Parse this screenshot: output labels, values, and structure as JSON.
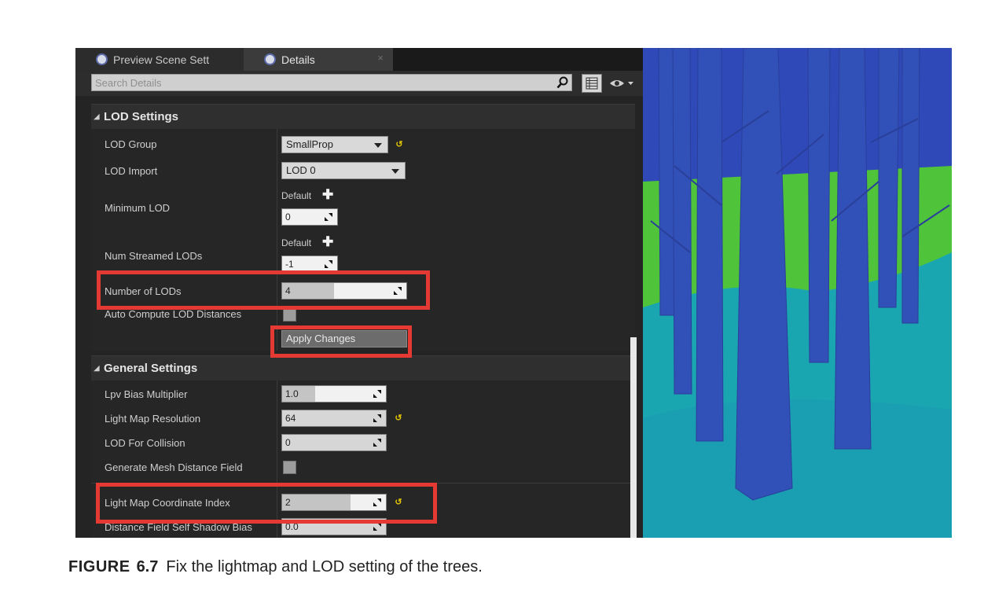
{
  "tabs": {
    "preview_label": "Preview Scene Sett",
    "details_label": "Details",
    "close_glyph": "×"
  },
  "search": {
    "placeholder": "Search Details"
  },
  "lod_settings": {
    "title": "LOD Settings",
    "lod_group": {
      "label": "LOD Group",
      "value": "SmallProp"
    },
    "lod_import": {
      "label": "LOD Import",
      "value": "LOD 0"
    },
    "minimum_lod": {
      "label": "Minimum LOD",
      "default_label": "Default",
      "value": "0"
    },
    "num_streamed_lods": {
      "label": "Num Streamed LODs",
      "default_label": "Default",
      "value": "-1"
    },
    "number_of_lods": {
      "label": "Number of LODs",
      "value": "4",
      "slider_fraction": 0.42
    },
    "auto_compute": {
      "label": "Auto Compute LOD Distances",
      "checked": false
    },
    "apply_button": "Apply Changes"
  },
  "general_settings": {
    "title": "General Settings",
    "lpv_bias": {
      "label": "Lpv Bias Multiplier",
      "value": "1.0",
      "slider_fraction": 0.32
    },
    "light_map_resolution": {
      "label": "Light Map Resolution",
      "value": "64"
    },
    "lod_for_collision": {
      "label": "LOD For Collision",
      "value": "0"
    },
    "generate_mesh_distance_field": {
      "label": "Generate Mesh Distance Field",
      "checked": false
    },
    "light_map_coordinate_index": {
      "label": "Light Map Coordinate Index",
      "value": "2",
      "slider_fraction": 0.66
    },
    "distance_field_self_shadow_bias": {
      "label": "Distance Field Self Shadow Bias",
      "value": "0.0"
    }
  },
  "caption": {
    "label": "FIGURE",
    "number": "6.7",
    "text": "Fix the lightmap and LOD setting of the trees."
  },
  "colors": {
    "highlight": "#e53a34",
    "reset_arrow": "#e2c400",
    "viewport_sky": "#2f49b8",
    "viewport_grass": "#4fc43a",
    "viewport_ground": "#1aa6b0",
    "tree_trunk": "#3150b8"
  }
}
